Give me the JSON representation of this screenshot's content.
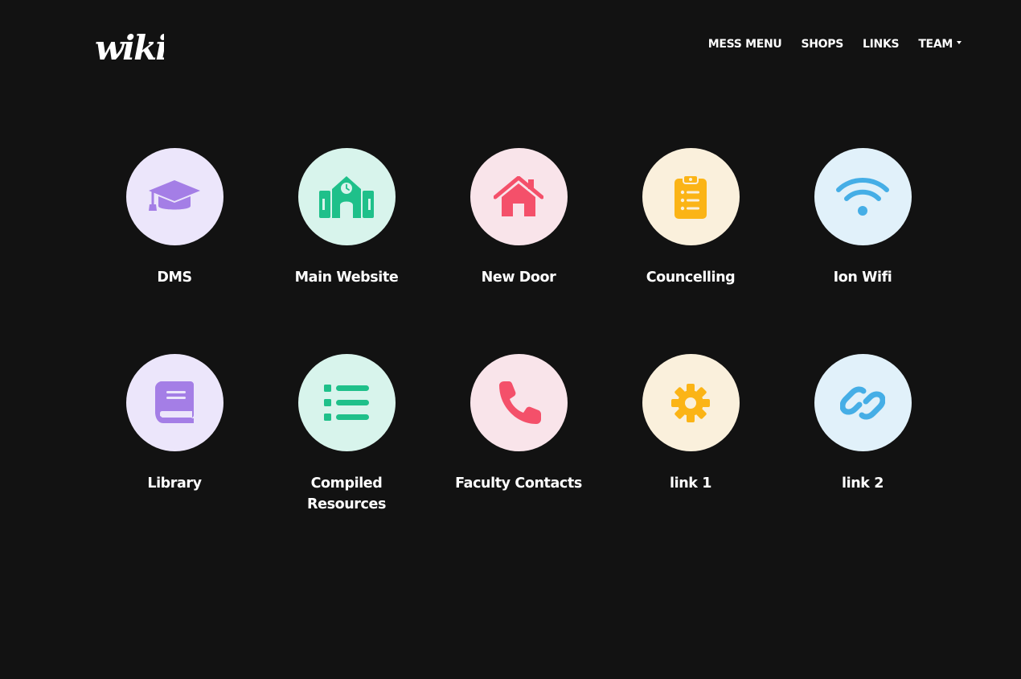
{
  "brand": {
    "logo_text": "wiki"
  },
  "nav": {
    "items": [
      {
        "label": "MESS MENU"
      },
      {
        "label": "SHOPS"
      },
      {
        "label": "LINKS"
      },
      {
        "label": "TEAM",
        "dropdown": true
      }
    ]
  },
  "tiles": [
    {
      "label": "DMS",
      "icon": "graduation-cap-icon",
      "color": "#a47ee6",
      "bg": "#ece6fb"
    },
    {
      "label": "Main Website",
      "icon": "school-building-icon",
      "color": "#1fc08a",
      "bg": "#d8f4ec"
    },
    {
      "label": "New Door",
      "icon": "house-icon",
      "color": "#f4506a",
      "bg": "#f9e4ea"
    },
    {
      "label": "Councelling",
      "icon": "clipboard-list-icon",
      "color": "#fbb416",
      "bg": "#faf0dc"
    },
    {
      "label": "Ion Wifi",
      "icon": "wifi-icon",
      "color": "#45aee6",
      "bg": "#e1f1fa"
    },
    {
      "label": "Library",
      "icon": "book-icon",
      "color": "#a47ee6",
      "bg": "#ece6fb"
    },
    {
      "label": "Compiled Resources",
      "icon": "list-icon",
      "color": "#1fc08a",
      "bg": "#d8f4ec"
    },
    {
      "label": "Faculty Contacts",
      "icon": "phone-icon",
      "color": "#f4506a",
      "bg": "#f9e4ea"
    },
    {
      "label": "link 1",
      "icon": "gear-icon",
      "color": "#fbb416",
      "bg": "#faf0dc"
    },
    {
      "label": "link 2",
      "icon": "link-icon",
      "color": "#45aee6",
      "bg": "#e1f1fa"
    }
  ]
}
